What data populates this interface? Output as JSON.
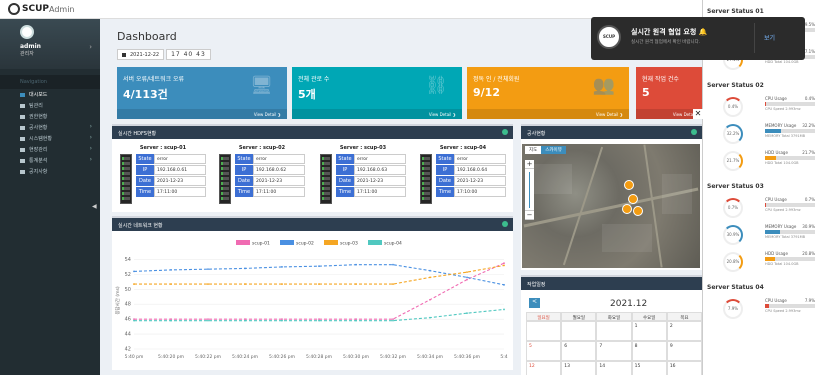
{
  "app": {
    "logo_bold": "SCUP",
    "logo_light": "Admin"
  },
  "user": {
    "name": "admin",
    "role": "관리자"
  },
  "nav": {
    "header": "Navigation",
    "items": [
      {
        "label": "대시보드",
        "active": true
      },
      {
        "label": "팀관리"
      },
      {
        "label": "권한현황"
      },
      {
        "label": "공사현황"
      },
      {
        "label": "시스템현황"
      },
      {
        "label": "현장관리"
      },
      {
        "label": "통계분석"
      },
      {
        "label": "공지사항"
      }
    ]
  },
  "page": {
    "title": "Dashboard",
    "date": "2021-12-22",
    "time": "17 40 43"
  },
  "stats": [
    {
      "label": "서버 오류/네트워크 오류",
      "value": "4/113건",
      "footer": "View Detail ❯",
      "color": "#3c8dbc"
    },
    {
      "label": "전체 관로 수",
      "value": "5개",
      "footer": "View Detail ❯",
      "color": "#00a7b5"
    },
    {
      "label": "정독 인 / 전체회원",
      "value": "9/12",
      "footer": "View Detail ❯",
      "color": "#f39c12"
    },
    {
      "label": "현재 작업 건수",
      "value": "5",
      "footer": "View Detail ❯",
      "color": "#dd4b39"
    }
  ],
  "hdfs": {
    "title": "실시간 HDFS현황",
    "servers": [
      {
        "name": "Server : scup-01",
        "state": "error",
        "ip": "192.168.0.61",
        "date": "2021-12-23",
        "time": "17:11:00"
      },
      {
        "name": "Server : scup-02",
        "state": "error",
        "ip": "192.168.0.62",
        "date": "2021-12-23",
        "time": "17:11:00"
      },
      {
        "name": "Server : scup-03",
        "state": "error",
        "ip": "192.168.0.63",
        "date": "2021-12-23",
        "time": "17:11:00"
      },
      {
        "name": "Server : scup-04",
        "state": "error",
        "ip": "192.168.0.64",
        "date": "2021-12-23",
        "time": "17:10:00"
      }
    ],
    "keys": {
      "state": "State",
      "ip": "IP",
      "date": "Date",
      "time": "Time"
    }
  },
  "network": {
    "title": "실시간 네트워크 현황"
  },
  "chart_data": {
    "type": "line",
    "title": "",
    "xlabel": "",
    "ylabel": "응답시간 (ms)",
    "x": [
      "5:40 pm",
      "5:40:20 pm",
      "5:40:22 pm",
      "5:40:24 pm",
      "5:40:26 pm",
      "5:40:28 pm",
      "5:40:30 pm",
      "5:40:32 pm",
      "5:40:34 pm",
      "5:40:36 pm",
      "5:4"
    ],
    "ylim": [
      42,
      55
    ],
    "yticks": [
      42,
      44,
      46,
      48,
      50,
      52,
      54
    ],
    "series": [
      {
        "name": "scup-01",
        "color": "#f06bb2",
        "values": [
          46,
          46,
          46,
          46,
          46,
          46,
          46,
          46,
          48.6,
          51.3,
          53.5
        ]
      },
      {
        "name": "scup-02",
        "color": "#4a90e2",
        "values": [
          52.4,
          52.6,
          52.7,
          52.8,
          53,
          53.1,
          53.3,
          53.3,
          52.5,
          51.6,
          50.6
        ]
      },
      {
        "name": "scup-03",
        "color": "#f5a623",
        "values": [
          50.7,
          50.7,
          50.7,
          50.7,
          50.7,
          50.7,
          50.7,
          50.7,
          51.6,
          52.3,
          53.2
        ]
      },
      {
        "name": "scup-04",
        "color": "#50c8c0",
        "values": [
          45.8,
          45.8,
          45.8,
          45.8,
          45.8,
          45.8,
          45.8,
          45.8,
          46.2,
          46.8,
          47.3
        ]
      }
    ]
  },
  "map": {
    "title": "공사현황",
    "type_map": "지도",
    "type_sat": "스카이뷰",
    "zoom_in": "+",
    "zoom_out": "−"
  },
  "schedule": {
    "title": "작업일정",
    "month": "2021.12",
    "prev": "<",
    "days": [
      "일요일",
      "월요일",
      "화요일",
      "수요일",
      "목요"
    ],
    "weeks": [
      [
        "",
        "",
        "",
        "1",
        "2"
      ],
      [
        "5",
        "6",
        "7",
        "8",
        "9"
      ],
      [
        "12",
        "13",
        "14",
        "15",
        "16"
      ]
    ]
  },
  "notification": {
    "logo": "SCUP",
    "title": "실시간 원격 협업 요청",
    "bell": "🔔",
    "message": "실시간 원격 협업에서 확인 바랍니다.",
    "action": "보기"
  },
  "server_status": [
    {
      "title": "Server Status 01",
      "rows": [
        {
          "gauge": "39.5%",
          "label": "MEMORY Usage",
          "val": "39.5%",
          "sub": "MEMORY Total 3791MB",
          "pct": 39.5,
          "color": "#3c8dbc"
        },
        {
          "gauge": "27.1%",
          "label": "HDD Usage",
          "val": "27.1%",
          "sub": "HDD Total 104.0GB",
          "pct": 27.1,
          "color": "#f39c12"
        }
      ]
    },
    {
      "title": "Server Status 02",
      "rows": [
        {
          "gauge": "0.4%",
          "label": "CPU Usage",
          "val": "0.4%",
          "sub": "CPU Speed 2.993mz",
          "pct": 2,
          "color": "#dd4b39"
        },
        {
          "gauge": "32.2%",
          "label": "MEMORY Usage",
          "val": "32.2%",
          "sub": "MEMORY Total 3791MB",
          "pct": 32.2,
          "color": "#3c8dbc"
        },
        {
          "gauge": "21.7%",
          "label": "HDD Usage",
          "val": "21.7%",
          "sub": "HDD Total 104.0GB",
          "pct": 21.7,
          "color": "#f39c12"
        }
      ]
    },
    {
      "title": "Server Status 03",
      "rows": [
        {
          "gauge": "0.7%",
          "label": "CPU Usage",
          "val": "0.7%",
          "sub": "CPU Speed 2.993mz",
          "pct": 2,
          "color": "#dd4b39"
        },
        {
          "gauge": "30.9%",
          "label": "MEMORY Usage",
          "val": "30.9%",
          "sub": "MEMORY Total 3791MB",
          "pct": 30.9,
          "color": "#3c8dbc"
        },
        {
          "gauge": "20.8%",
          "label": "HDD Usage",
          "val": "20.8%",
          "sub": "HDD Total 104.0GB",
          "pct": 20.8,
          "color": "#f39c12"
        }
      ]
    },
    {
      "title": "Server Status 04",
      "rows": [
        {
          "gauge": "7.9%",
          "label": "CPU Usage",
          "val": "7.9%",
          "sub": "CPU Speed 2.993mz",
          "pct": 7.9,
          "color": "#dd4b39"
        }
      ]
    }
  ]
}
